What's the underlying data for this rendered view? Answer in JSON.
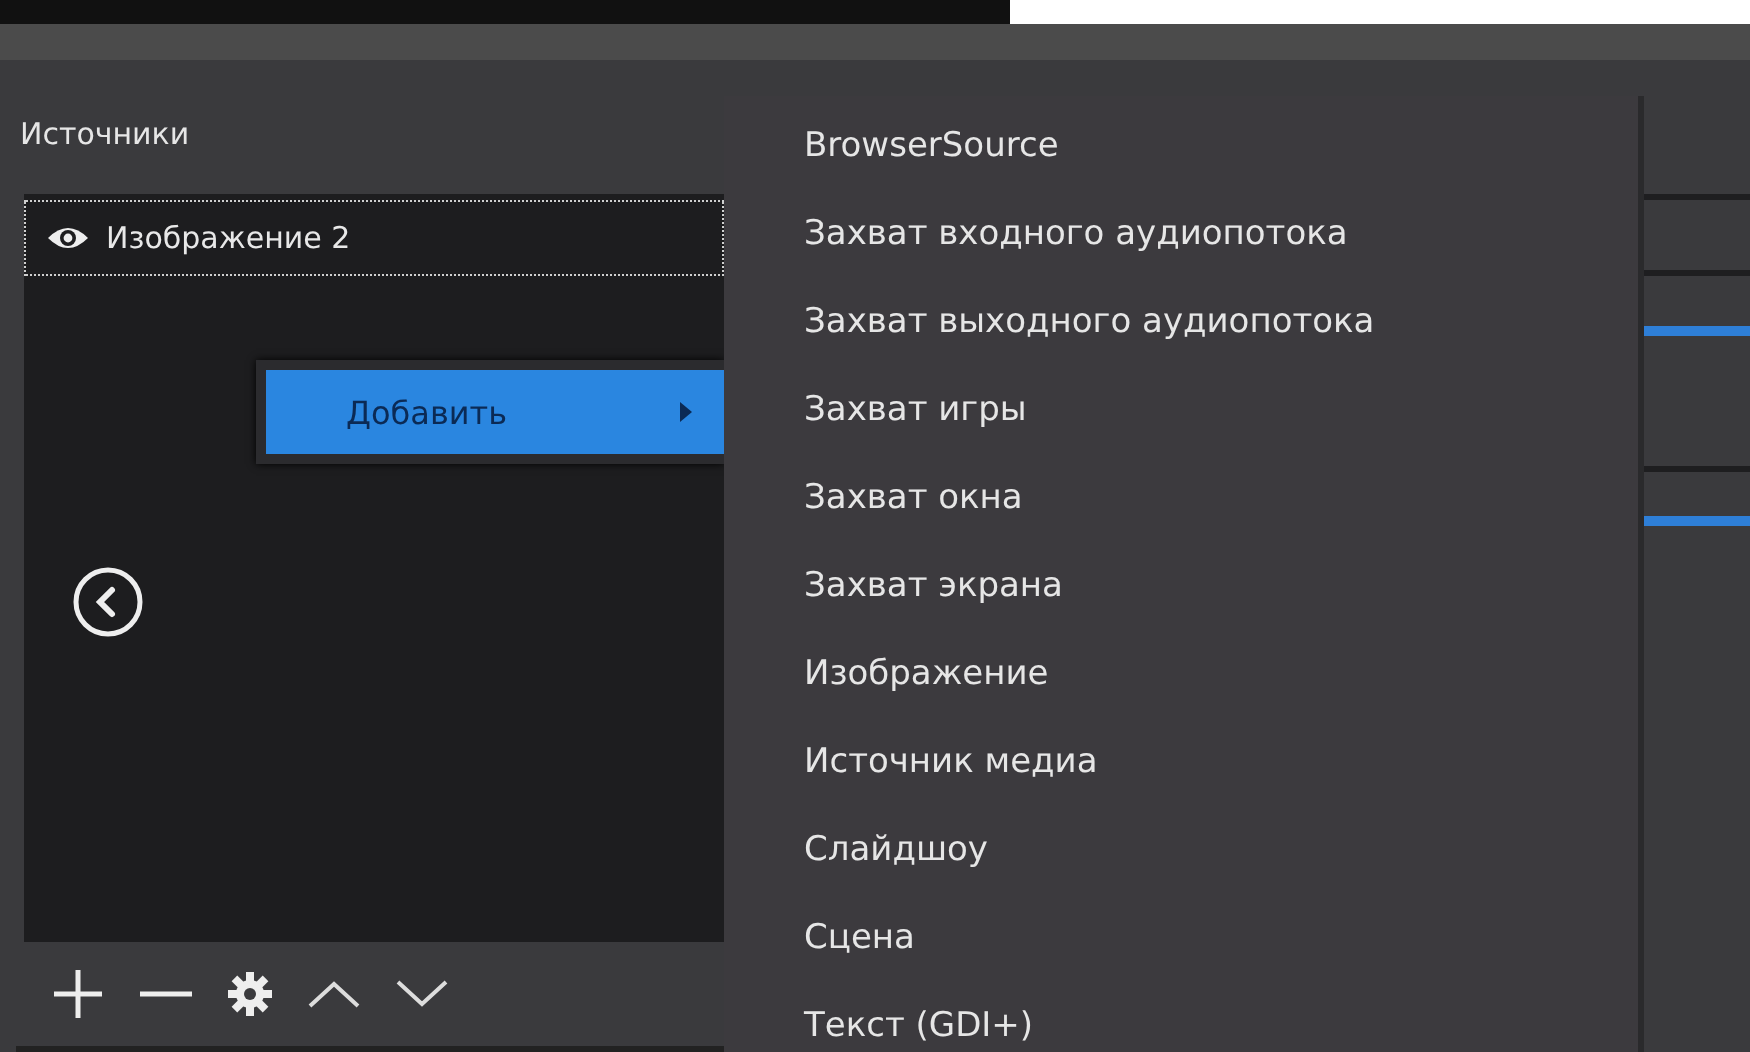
{
  "sources": {
    "title": "Источники",
    "items": [
      {
        "label": "Изображение 2",
        "visible": true,
        "selected": true
      }
    ]
  },
  "context_menu": {
    "items": [
      {
        "label": "Добавить",
        "selected": true,
        "submenu": true
      }
    ]
  },
  "submenu": {
    "items": [
      {
        "label": "BrowserSource"
      },
      {
        "label": "Захват входного аудиопотока"
      },
      {
        "label": "Захват выходного аудиопотока"
      },
      {
        "label": "Захват игры"
      },
      {
        "label": "Захват окна"
      },
      {
        "label": "Захват экрана"
      },
      {
        "label": "Изображение"
      },
      {
        "label": "Источник медиа"
      },
      {
        "label": "Слайдшоу"
      },
      {
        "label": "Сцена"
      },
      {
        "label": "Текст (GDI+)"
      }
    ]
  }
}
